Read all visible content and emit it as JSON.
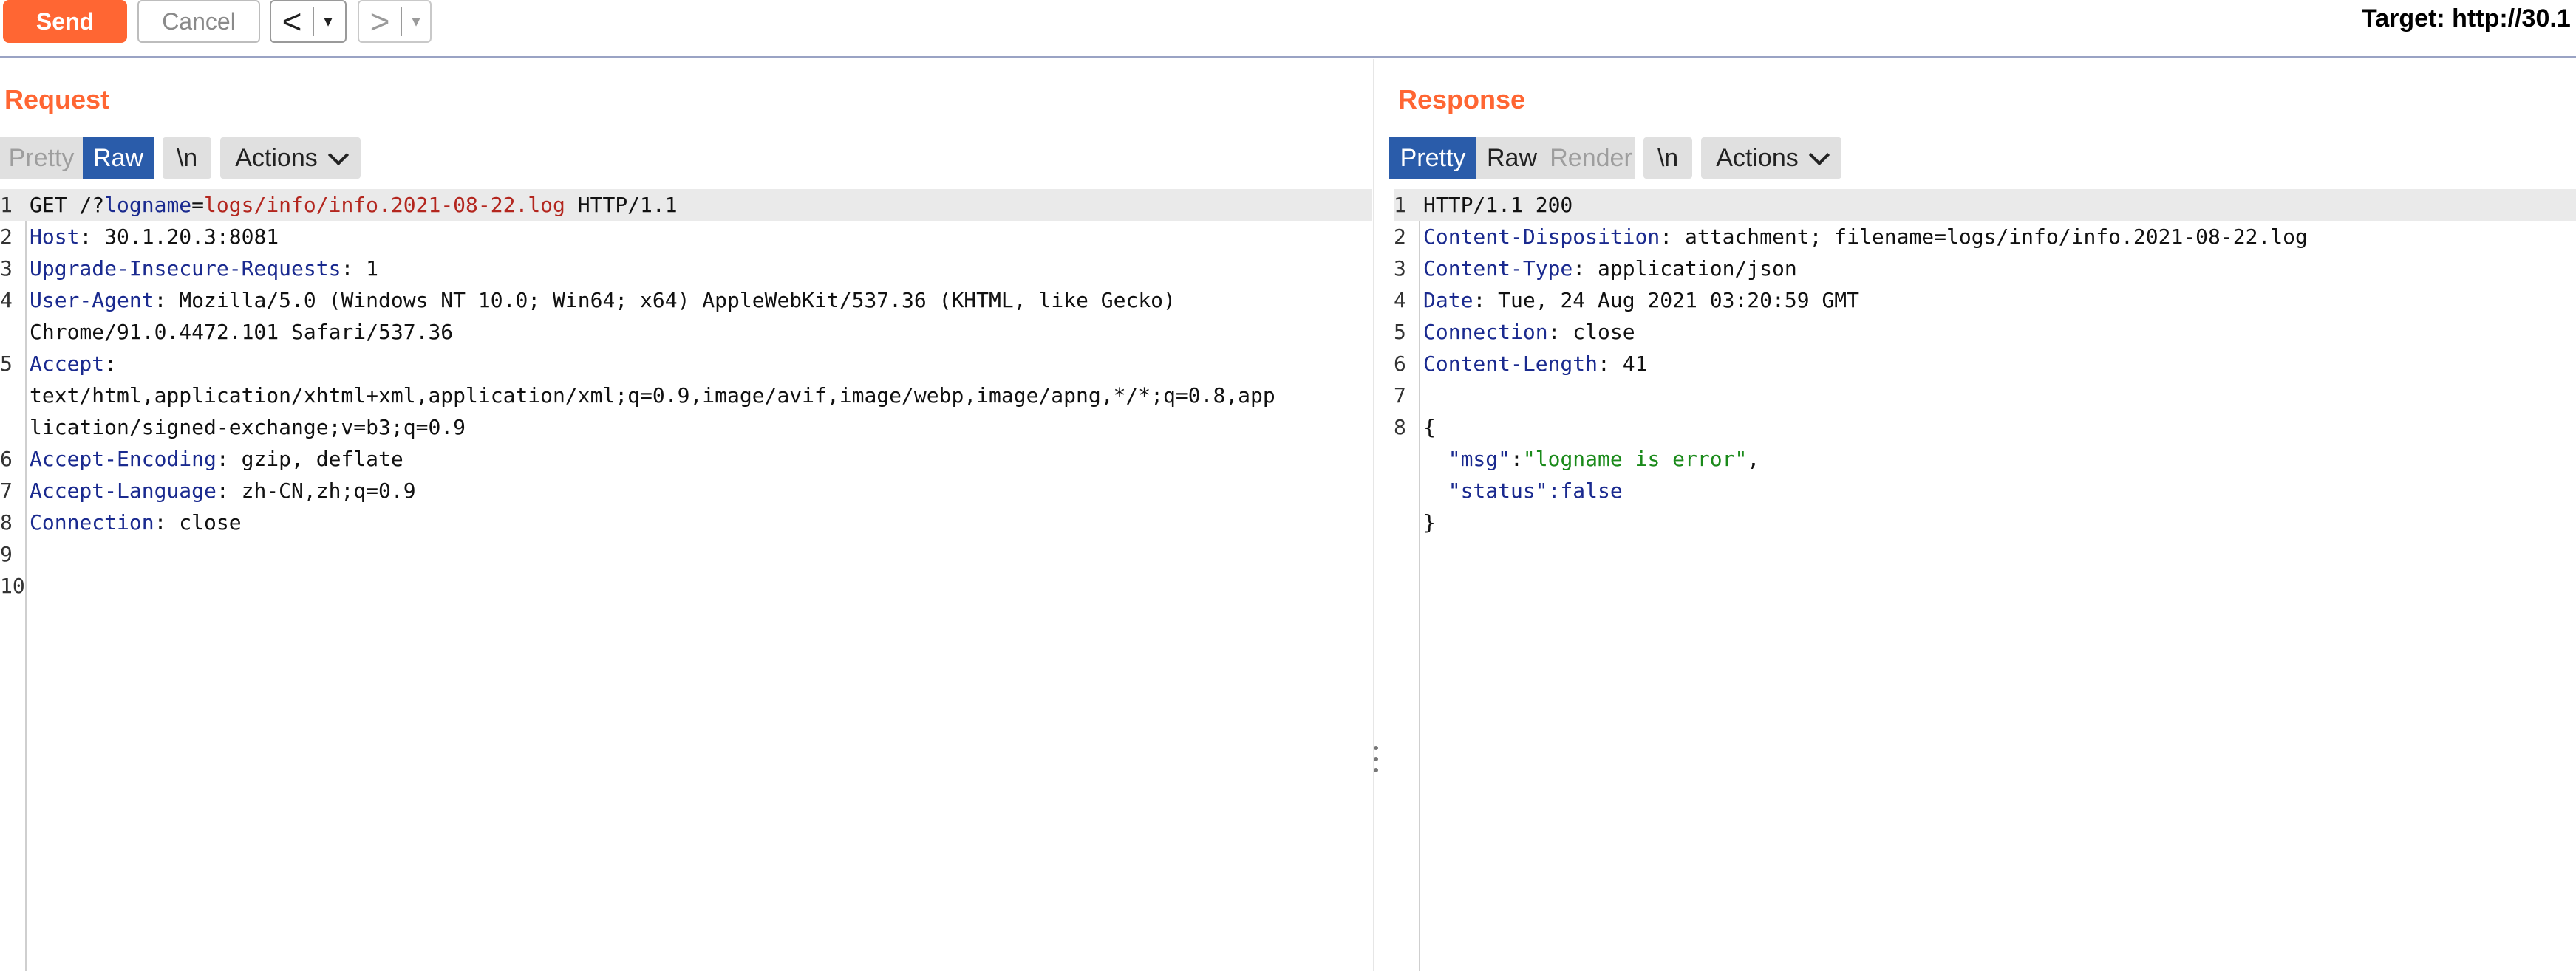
{
  "toolbar": {
    "send_label": "Send",
    "cancel_label": "Cancel",
    "back_glyph": "<",
    "forward_glyph": ">",
    "dropdown_glyph": "▾",
    "target_text": "Target: http://30.1"
  },
  "request": {
    "title": "Request",
    "tabs": [
      "Pretty",
      "Raw",
      "\\n",
      "Actions"
    ],
    "active_tab": "Raw",
    "lines": [
      {
        "n": "1",
        "parts": [
          [
            "GET /?",
            "v"
          ],
          [
            "logname",
            "k"
          ],
          [
            "=",
            "v"
          ],
          [
            "logs/info/info.2021-08-22.log",
            "red"
          ],
          [
            " HTTP/1.1",
            "v"
          ]
        ]
      },
      {
        "n": "2",
        "parts": [
          [
            "Host",
            "k"
          ],
          [
            ": 30.1.20.3:8081",
            "v"
          ]
        ]
      },
      {
        "n": "3",
        "parts": [
          [
            "Upgrade-Insecure-Requests",
            "k"
          ],
          [
            ": 1",
            "v"
          ]
        ]
      },
      {
        "n": "4",
        "parts": [
          [
            "User-Agent",
            "k"
          ],
          [
            ": Mozilla/5.0 (Windows NT 10.0; Win64; x64) AppleWebKit/537.36 (KHTML, like Gecko)",
            "v"
          ]
        ]
      },
      {
        "n": "",
        "parts": [
          [
            "Chrome/91.0.4472.101 Safari/537.36",
            "v"
          ]
        ]
      },
      {
        "n": "5",
        "parts": [
          [
            "Accept",
            "k"
          ],
          [
            ":",
            "v"
          ]
        ]
      },
      {
        "n": "",
        "parts": [
          [
            "text/html,application/xhtml+xml,application/xml;q=0.9,image/avif,image/webp,image/apng,*/*;q=0.8,app",
            "v"
          ]
        ]
      },
      {
        "n": "",
        "parts": [
          [
            "lication/signed-exchange;v=b3;q=0.9",
            "v"
          ]
        ]
      },
      {
        "n": "6",
        "parts": [
          [
            "Accept-Encoding",
            "k"
          ],
          [
            ": gzip, deflate",
            "v"
          ]
        ]
      },
      {
        "n": "7",
        "parts": [
          [
            "Accept-Language",
            "k"
          ],
          [
            ": zh-CN,zh;q=0.9",
            "v"
          ]
        ]
      },
      {
        "n": "8",
        "parts": [
          [
            "Connection",
            "k"
          ],
          [
            ": close",
            "v"
          ]
        ]
      },
      {
        "n": "9",
        "parts": []
      },
      {
        "n": "10",
        "parts": []
      }
    ]
  },
  "response": {
    "title": "Response",
    "tabs": [
      "Pretty",
      "Raw",
      "Render",
      "\\n",
      "Actions"
    ],
    "active_tab": "Pretty",
    "lines": [
      {
        "n": "1",
        "parts": [
          [
            "HTTP/1.1 200",
            "v"
          ]
        ]
      },
      {
        "n": "2",
        "parts": [
          [
            "Content-Disposition",
            "k"
          ],
          [
            ": attachment; filename=logs/info/info.2021-08-22.log",
            "v"
          ]
        ]
      },
      {
        "n": "3",
        "parts": [
          [
            "Content-Type",
            "k"
          ],
          [
            ": application/json",
            "v"
          ]
        ]
      },
      {
        "n": "4",
        "parts": [
          [
            "Date",
            "k"
          ],
          [
            ": Tue, 24 Aug 2021 03:20:59 GMT",
            "v"
          ]
        ]
      },
      {
        "n": "5",
        "parts": [
          [
            "Connection",
            "k"
          ],
          [
            ": close",
            "v"
          ]
        ]
      },
      {
        "n": "6",
        "parts": [
          [
            "Content-Length",
            "k"
          ],
          [
            ": 41",
            "v"
          ]
        ]
      },
      {
        "n": "7",
        "parts": []
      },
      {
        "n": "8",
        "parts": [
          [
            "{",
            "v"
          ]
        ]
      },
      {
        "n": "",
        "parts": [
          [
            "  \"msg\"",
            "k"
          ],
          [
            ":",
            "v"
          ],
          [
            "\"logname is error\"",
            "str"
          ],
          [
            ",",
            "v"
          ]
        ]
      },
      {
        "n": "",
        "parts": [
          [
            "  \"status\"",
            "k"
          ],
          [
            ":false",
            "k"
          ]
        ]
      },
      {
        "n": "",
        "parts": [
          [
            "}",
            "v"
          ]
        ]
      }
    ]
  },
  "colors": {
    "accent": "#ff6633",
    "active_tab": "#2a5caa",
    "key": "#1a2a8f",
    "param_value": "#b3261e",
    "json_string": "#1a8a1a"
  }
}
